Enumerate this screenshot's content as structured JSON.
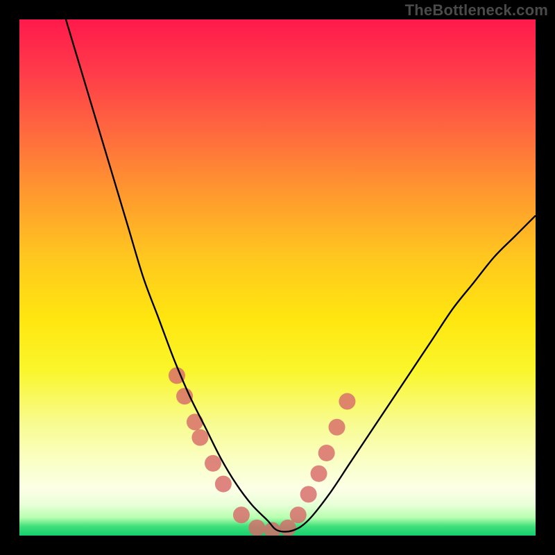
{
  "watermark": "TheBottleneck.com",
  "chart_data": {
    "type": "line",
    "title": "",
    "xlabel": "",
    "ylabel": "",
    "xlim": [
      0,
      100
    ],
    "ylim": [
      0,
      100
    ],
    "x": [
      9,
      12,
      15,
      18,
      21,
      24,
      27,
      30,
      33,
      36,
      39,
      42,
      45,
      48,
      50,
      53,
      56,
      60,
      64,
      68,
      72,
      76,
      80,
      84,
      88,
      92,
      96,
      100
    ],
    "values": [
      100,
      90,
      80,
      70,
      60,
      50,
      42,
      34,
      27,
      21,
      15,
      10,
      6,
      3,
      1,
      1,
      3,
      8,
      14,
      20,
      26,
      32,
      38,
      44,
      49,
      54,
      58,
      62
    ],
    "markers": {
      "x": [
        30.5,
        32,
        34,
        35,
        37.5,
        39.5,
        43,
        46,
        49,
        52,
        54,
        56,
        58,
        59.5,
        61.5,
        63.5
      ],
      "y": [
        31,
        27,
        22,
        19,
        14,
        10,
        4,
        1.5,
        1,
        1.5,
        4,
        8,
        12,
        16,
        21,
        26
      ],
      "color": "#d86a6a",
      "radius": 12
    },
    "curve_color": "#000000",
    "background": "rainbow-vertical-gradient"
  }
}
